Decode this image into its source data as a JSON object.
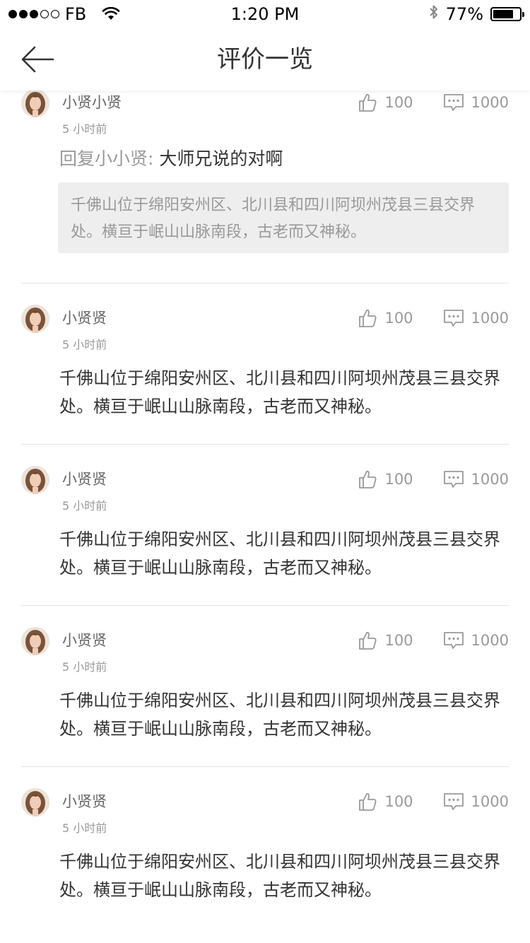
{
  "status_bar": {
    "carrier": "FB",
    "time": "1:20 PM",
    "battery": "77%",
    "battery_level": 0.77,
    "signal_icon": "signal-dots-icon",
    "wifi_icon": "wifi-icon",
    "bluetooth_icon": "bluetooth-icon"
  },
  "nav": {
    "title": "评价一览",
    "back_icon": "back-arrow-icon"
  },
  "comments": [
    {
      "user": "小贤小贤",
      "time_ago": "5 小时前",
      "likes": "100",
      "replies": "1000",
      "reply_prefix": "回复小小贤:",
      "reply_text": "大师兄说的对啊",
      "quote": "千佛山位于绵阳安州区、北川县和四川阿坝州茂县三县交界处。横亘于岷山山脉南段，古老而又神秘。"
    },
    {
      "user": "小贤贤",
      "time_ago": "5 小时前",
      "likes": "100",
      "replies": "1000",
      "text": "千佛山位于绵阳安州区、北川县和四川阿坝州茂县三县交界处。横亘于岷山山脉南段，古老而又神秘。"
    },
    {
      "user": "小贤贤",
      "time_ago": "5 小时前",
      "likes": "100",
      "replies": "1000",
      "text": "千佛山位于绵阳安州区、北川县和四川阿坝州茂县三县交界处。横亘于岷山山脉南段，古老而又神秘。"
    },
    {
      "user": "小贤贤",
      "time_ago": "5 小时前",
      "likes": "100",
      "replies": "1000",
      "text": "千佛山位于绵阳安州区、北川县和四川阿坝州茂县三县交界处。横亘于岷山山脉南段，古老而又神秘。"
    },
    {
      "user": "小贤贤",
      "time_ago": "5 小时前",
      "likes": "100",
      "replies": "1000",
      "text": "千佛山位于绵阳安州区、北川县和四川阿坝州茂县三县交界处。横亘于岷山山脉南段，古老而又神秘。"
    }
  ],
  "icons": {
    "like": "thumbs-up-icon",
    "comment": "comment-bubble-icon",
    "avatar": "avatar"
  },
  "colors": {
    "primary_text": "#333333",
    "secondary_text": "#999999",
    "quote_background": "#eeeeee",
    "divider": "#e5e5e5"
  }
}
